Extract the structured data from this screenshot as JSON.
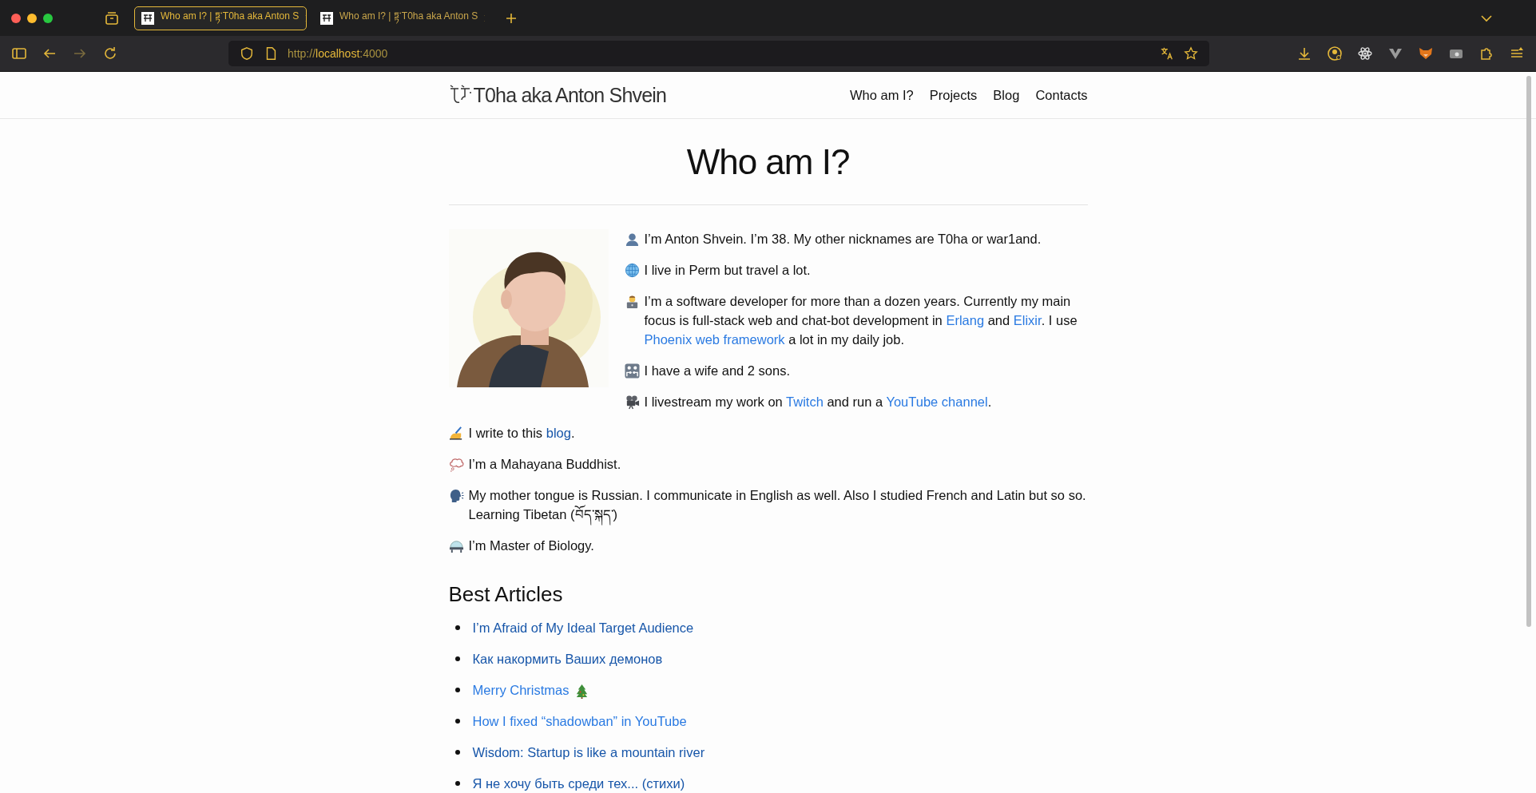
{
  "browser": {
    "tabs": [
      {
        "title": "Who am I? | ཏྟ་T0ha aka Anton S",
        "selected": true
      },
      {
        "title": "Who am I? | ཏྟ་T0ha aka Anton S",
        "selected": false
      }
    ],
    "url": {
      "scheme": "http://",
      "host": "localhost",
      "port": ":4000"
    }
  },
  "site": {
    "logo": "T0ha aka Anton Shvein",
    "nav": [
      "Who am I?",
      "Projects",
      "Blog",
      "Contacts"
    ]
  },
  "page": {
    "title": "Who am I?",
    "intro": [
      {
        "kind": "person",
        "parts": [
          {
            "kind": "text",
            "text": "I’m Anton Shvein. I’m 38. My other nicknames are T0ha or war1and."
          }
        ]
      },
      {
        "kind": "globe",
        "parts": [
          {
            "kind": "text",
            "text": "I live in Perm but travel a lot."
          }
        ]
      },
      {
        "kind": "developer",
        "parts": [
          {
            "kind": "text",
            "text": "I’m a software developer for more than a dozen years. Currently my main focus is full-stack web and chat-bot development in "
          },
          {
            "kind": "link",
            "text": "Erlang",
            "visited": false
          },
          {
            "kind": "text",
            "text": " and "
          },
          {
            "kind": "link",
            "text": "Elixir",
            "visited": false
          },
          {
            "kind": "text",
            "text": ". I use "
          },
          {
            "kind": "link",
            "text": "Phoenix web framework",
            "visited": false
          },
          {
            "kind": "text",
            "text": " a lot in my daily job."
          }
        ]
      },
      {
        "kind": "family",
        "parts": [
          {
            "kind": "text",
            "text": "I have a wife and 2 sons."
          }
        ]
      },
      {
        "kind": "camera",
        "parts": [
          {
            "kind": "text",
            "text": "I livestream my work on "
          },
          {
            "kind": "link",
            "text": "Twitch",
            "visited": false
          },
          {
            "kind": "text",
            "text": " and run a "
          },
          {
            "kind": "link",
            "text": "YouTube channel",
            "visited": false
          },
          {
            "kind": "text",
            "text": "."
          }
        ]
      }
    ],
    "more": [
      {
        "kind": "hand",
        "parts": [
          {
            "kind": "text",
            "text": "I write to this "
          },
          {
            "kind": "link",
            "text": "blog",
            "visited": true
          },
          {
            "kind": "text",
            "text": "."
          }
        ]
      },
      {
        "kind": "bubble",
        "parts": [
          {
            "kind": "text",
            "text": "I’m a Mahayana Buddhist."
          }
        ]
      },
      {
        "kind": "speaker",
        "parts": [
          {
            "kind": "text",
            "text": "My mother tongue is Russian. I communicate in English as well. Also I studied French and Latin but so so. Learning Tibetan (བོད་སྐད་)"
          }
        ]
      },
      {
        "kind": "graduate",
        "parts": [
          {
            "kind": "text",
            "text": "I’m Master of Biology."
          }
        ]
      }
    ],
    "articles_title": "Best Articles",
    "articles": [
      {
        "kind": "link",
        "text": "I’m Afraid of My Ideal Target Audience",
        "visited": true
      },
      {
        "kind": "link",
        "text": "Как накормить Ваших демонов",
        "visited": true
      },
      {
        "kind": "link_with_tree",
        "text": "Merry Christmas",
        "visited": false
      },
      {
        "kind": "link",
        "text": "How I fixed “shadowban” in YouTube",
        "visited": false
      },
      {
        "kind": "link",
        "text": "Wisdom: Startup is like a mountain river",
        "visited": true
      },
      {
        "kind": "link",
        "text": "Я не хочу быть среди тех... (стихи)",
        "visited": true
      }
    ]
  }
}
